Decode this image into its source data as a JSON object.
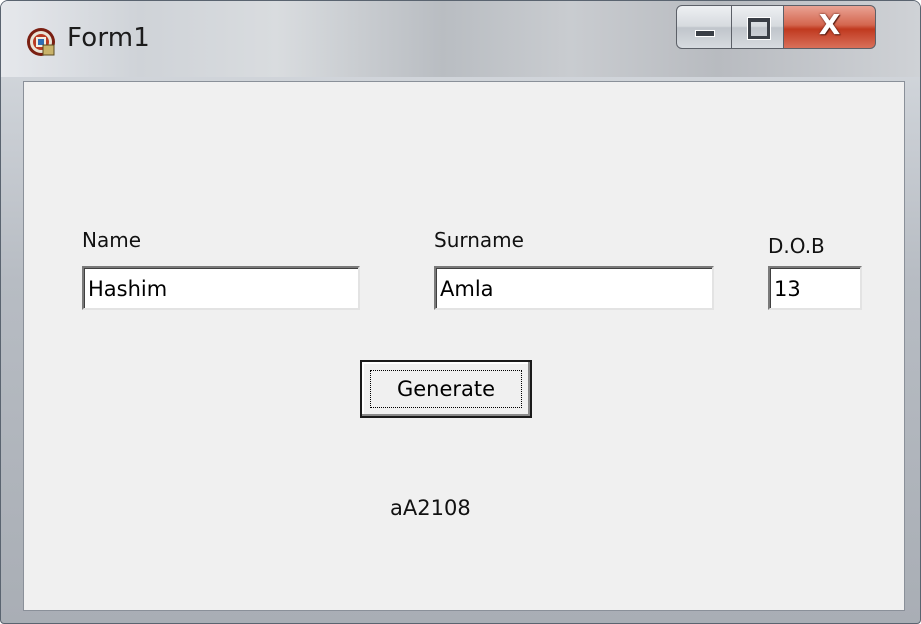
{
  "window": {
    "title": "Form1",
    "app_icon": "delphi-app-icon",
    "controls": {
      "minimize_icon": "minimize-icon",
      "maximize_icon": "maximize-icon",
      "close_icon": "close-icon",
      "close_glyph": "X"
    },
    "colors": {
      "close_button": "#c74a30",
      "client_background": "#f0f0f0"
    }
  },
  "form": {
    "name": {
      "label": "Name",
      "value": "Hashim"
    },
    "surname": {
      "label": "Surname",
      "value": "Amla"
    },
    "dob": {
      "label": "D.O.B",
      "value": "13"
    },
    "generate_button": {
      "label": "Generate"
    },
    "result_text": "aA2108"
  }
}
